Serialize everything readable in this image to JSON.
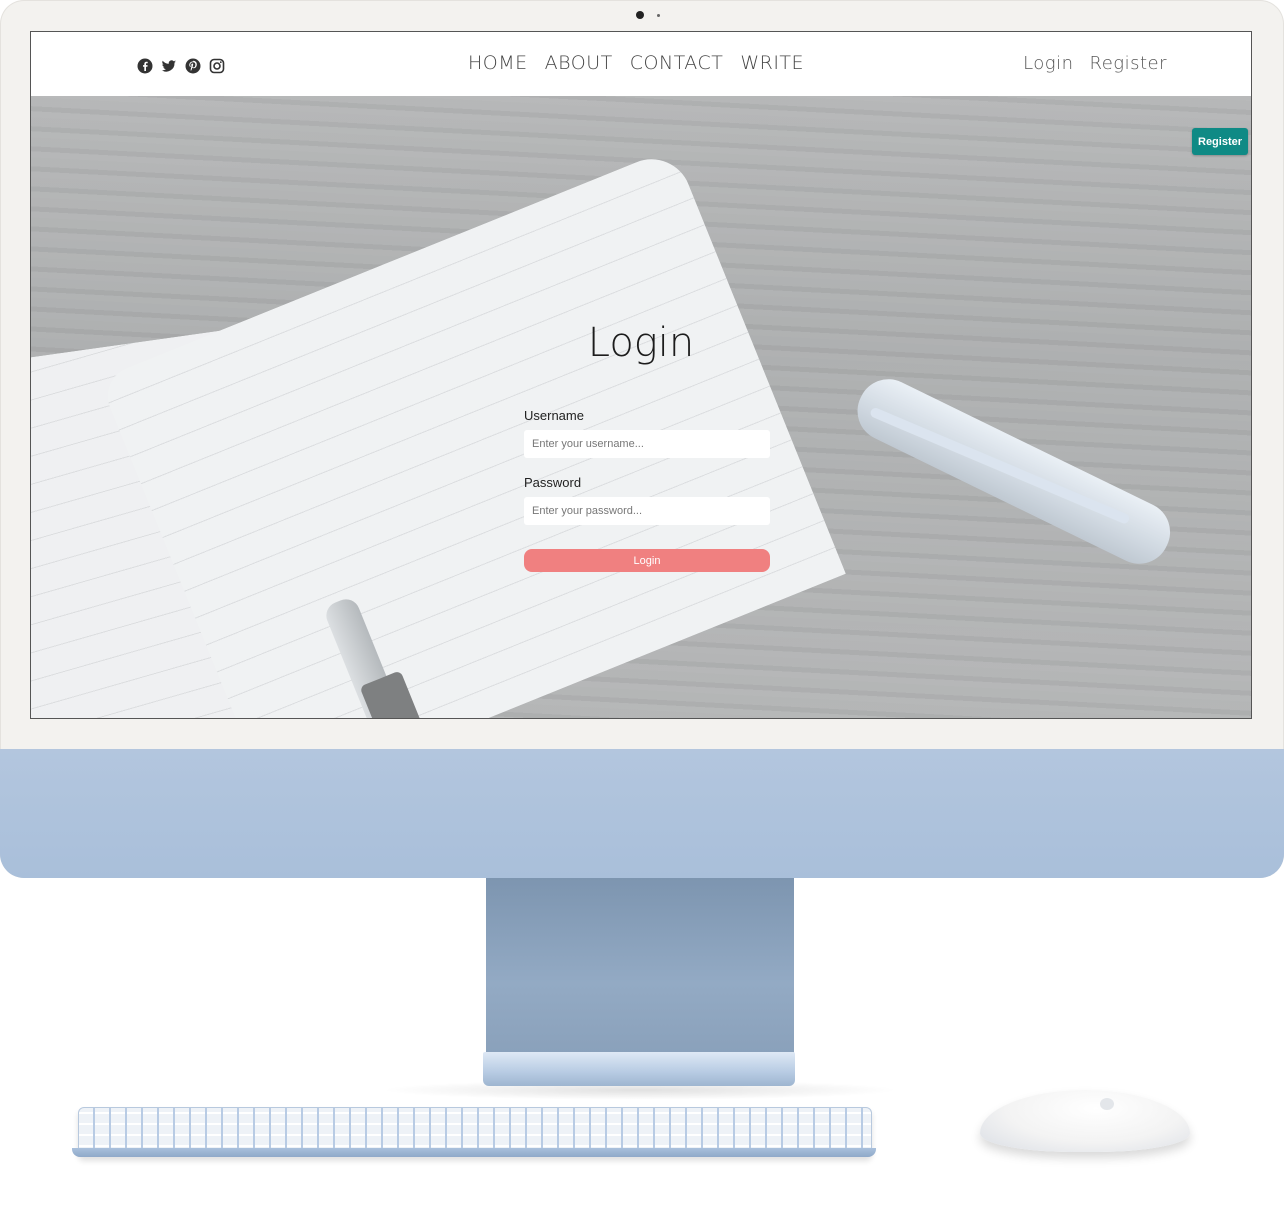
{
  "nav": {
    "social_icons": [
      "facebook-icon",
      "twitter-icon",
      "pinterest-icon",
      "instagram-icon"
    ],
    "links": [
      {
        "label": "HOME"
      },
      {
        "label": "ABOUT"
      },
      {
        "label": "CONTACT"
      },
      {
        "label": "WRITE"
      }
    ],
    "login": "Login",
    "register": "Register"
  },
  "hero": {
    "register_button": "Register",
    "title": "Login",
    "username_label": "Username",
    "username_placeholder": "Enter your username...",
    "password_label": "Password",
    "password_placeholder": "Enter your password...",
    "login_button": "Login"
  },
  "colors": {
    "register_button": "#0f8a85",
    "login_button": "#f08080",
    "device_accent": "#aec3dd"
  }
}
